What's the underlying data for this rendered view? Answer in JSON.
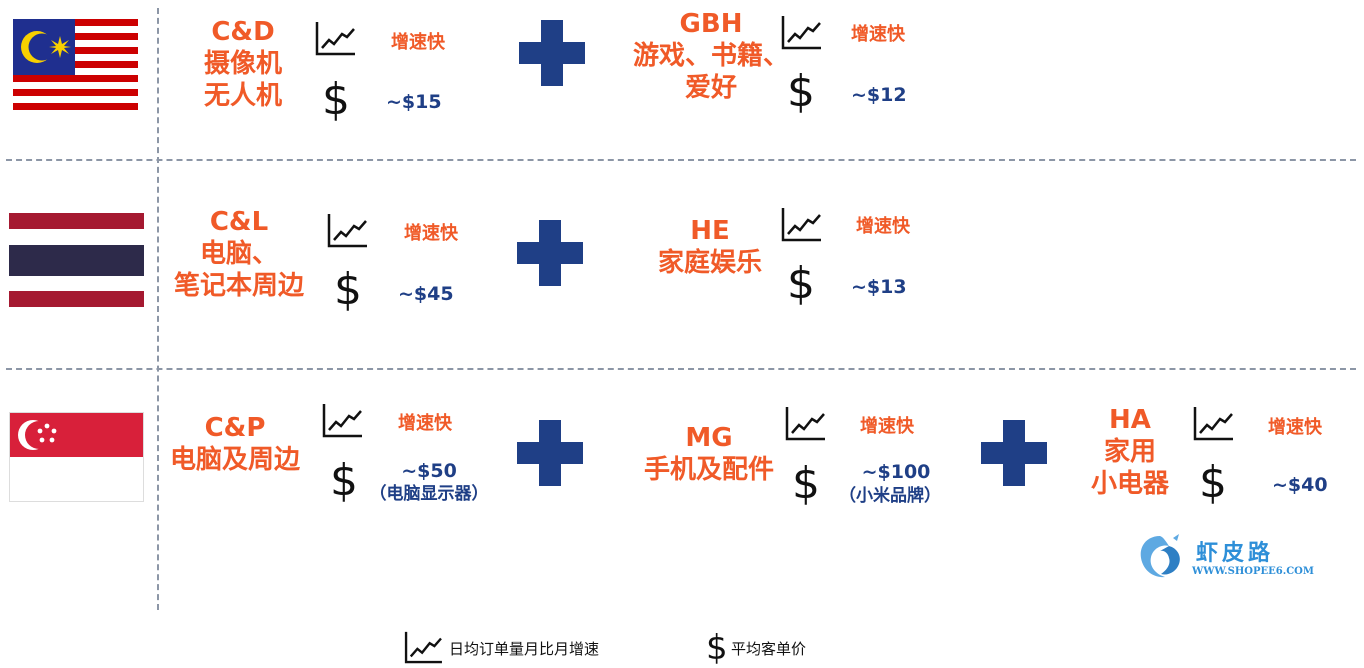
{
  "rows": [
    {
      "country_flag": "malaysia-flag",
      "categories": [
        {
          "name": "C&D\n摄像机\n无人机",
          "growth": "增速快",
          "price": "~$15",
          "note": ""
        },
        {
          "name": "GBH\n游戏、书籍、\n爱好",
          "growth": "增速快",
          "price": "~$12",
          "note": ""
        }
      ]
    },
    {
      "country_flag": "thailand-flag",
      "categories": [
        {
          "name": "C&L\n电脑、\n笔记本周边",
          "growth": "增速快",
          "price": "~$45",
          "note": ""
        },
        {
          "name": "HE\n家庭娱乐",
          "growth": "增速快",
          "price": "~$13",
          "note": ""
        }
      ]
    },
    {
      "country_flag": "singapore-flag",
      "categories": [
        {
          "name": "C&P\n电脑及周边",
          "growth": "增速快",
          "price": "~$50",
          "note": "（电脑显示器）"
        },
        {
          "name": "MG\n手机及配件",
          "growth": "增速快",
          "price": "~$100",
          "note": "（小米品牌）"
        },
        {
          "name": "HA\n家用\n小电器",
          "growth": "增速快",
          "price": "~$40",
          "note": ""
        }
      ]
    }
  ],
  "dollar_symbol": "$",
  "legend": {
    "growth_label": "日均订单量月比月增速",
    "price_label": "平均客单价",
    "dollar_symbol": "$"
  },
  "watermark": {
    "name": "虾皮路",
    "url": "WWW.SHOPEE6.COM"
  },
  "colors": {
    "accent_orange": "#f05a28",
    "navy": "#1f3f86",
    "divider": "#8c96a6"
  }
}
